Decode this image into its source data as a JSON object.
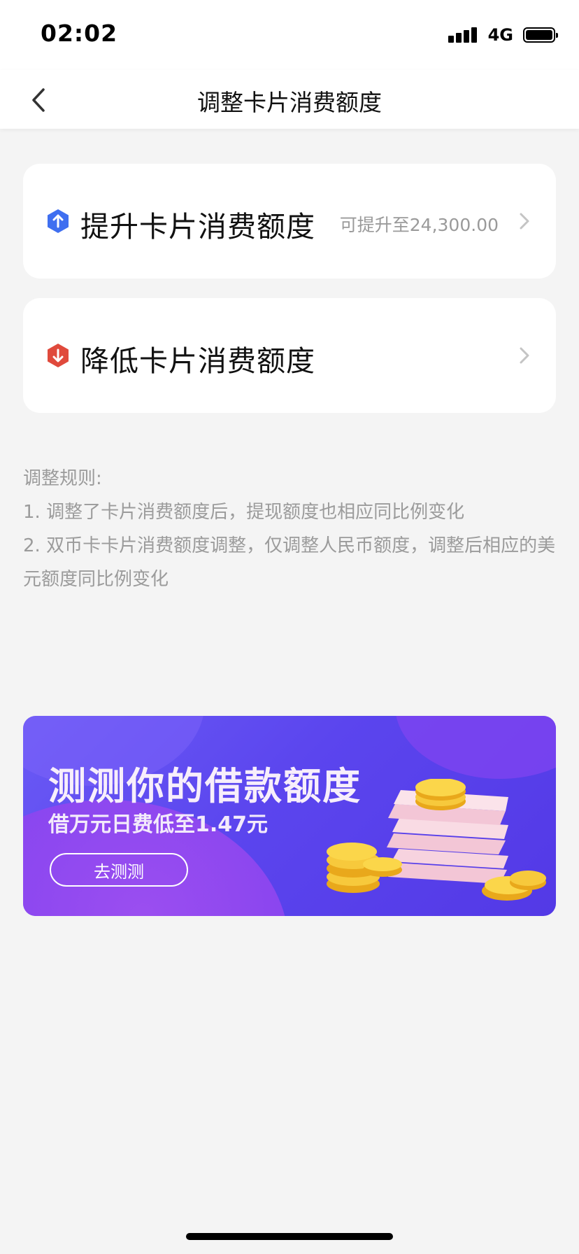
{
  "status_bar": {
    "time": "02:02",
    "network": "4G"
  },
  "nav": {
    "title": "调整卡片消费额度"
  },
  "options": [
    {
      "title": "提升卡片消费额度",
      "hint": "可提升至24,300.00"
    },
    {
      "title": "降低卡片消费额度",
      "hint": ""
    }
  ],
  "rules": {
    "heading": "调整规则:",
    "items": [
      "1. 调整了卡片消费额度后，提现额度也相应同比例变化",
      "2. 双币卡卡片消费额度调整，仅调整人民币额度，调整后相应的美元额度同比例变化"
    ]
  },
  "banner": {
    "title": "测测你的借款额度",
    "subtitle": "借万元日费低至1.47元",
    "button": "去测测"
  },
  "colors": {
    "raise_icon": "#3f6ff0",
    "lower_icon": "#e04a3c",
    "banner_bg": "#5b45ee"
  }
}
